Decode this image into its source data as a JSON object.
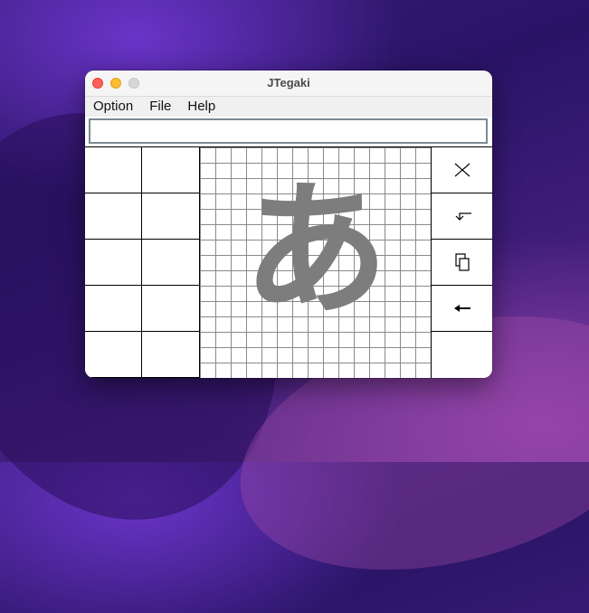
{
  "window": {
    "title": "JTegaki"
  },
  "menu": [
    "Option",
    "File",
    "Help"
  ],
  "input": {
    "value": ""
  },
  "candidates": [
    "",
    "",
    "",
    "",
    "",
    "",
    "",
    "",
    "",
    ""
  ],
  "canvas": {
    "drawn_character": "あ"
  },
  "tools": [
    {
      "name": "clear-icon"
    },
    {
      "name": "enter-icon"
    },
    {
      "name": "copy-icon"
    },
    {
      "name": "backspace-icon"
    },
    {
      "name": ""
    }
  ]
}
